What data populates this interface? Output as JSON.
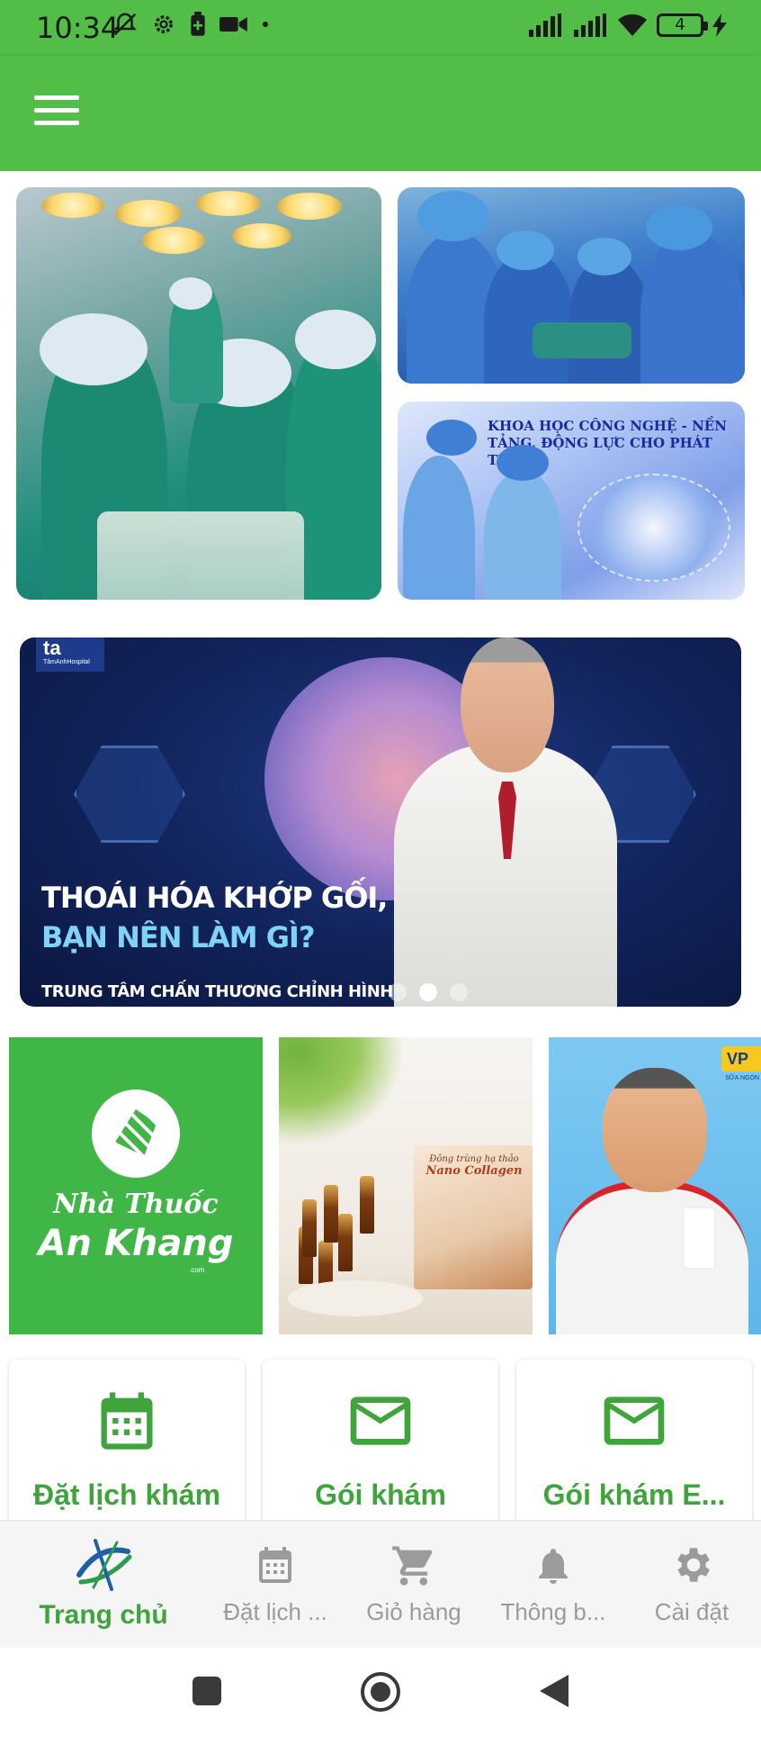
{
  "status_bar": {
    "time": "10:34",
    "battery_level": "4",
    "icons_left": [
      "muted-bell-icon",
      "gear-icon",
      "battery-saver-icon",
      "video-camera-icon",
      "dot-icon"
    ],
    "icons_right": [
      "signal-icon",
      "signal-icon",
      "wifi-icon",
      "battery-icon",
      "charging-bolt-icon"
    ]
  },
  "app_bar": {
    "menu_icon": "hamburger-menu-icon",
    "background_color": "#52bd47"
  },
  "gallery": {
    "science_caption": "KHOA HỌC CÔNG NGHỆ - NỀN TẢNG, ĐỘNG LỰC CHO PHÁT TRIỂN"
  },
  "banner": {
    "logo_text": "ta",
    "logo_subtext": "TâmAnhHospital",
    "headline_1": "THOÁI HÓA KHỚP GỐI,",
    "headline_2": "BẠN NÊN LÀM GÌ?",
    "footer": "TRUNG TÂM CHẤN THƯƠNG CHỈNH HÌNH",
    "slide_count": 3,
    "active_slide": 2
  },
  "ads": {
    "ankhang_line1": "Nhà Thuốc",
    "ankhang_line2": "An Khang",
    "ankhang_com": ".com",
    "collagen_small": "Đông trùng hạ thảo",
    "collagen_name": "Nano Collagen",
    "vp_badge": "VP",
    "vp_sub": "SỮA NGON"
  },
  "cards": [
    {
      "label": "Đặt lịch khám",
      "icon": "calendar-icon"
    },
    {
      "label": "Gói khám",
      "icon": "mail-icon"
    },
    {
      "label": "Gói khám E...",
      "icon": "mail-icon"
    }
  ],
  "bottom_nav": [
    {
      "label": "Trang chủ",
      "icon": "app-logo-icon",
      "active": true
    },
    {
      "label": "Đặt lịch ...",
      "icon": "calendar-icon",
      "active": false
    },
    {
      "label": "Giỏ hàng",
      "icon": "cart-icon",
      "active": false
    },
    {
      "label": "Thông b...",
      "icon": "bell-icon",
      "active": false
    },
    {
      "label": "Cài đặt",
      "icon": "gear-icon",
      "active": false
    }
  ],
  "colors": {
    "brand_green": "#52bd47",
    "accent_green": "#3ea43b",
    "nav_inactive": "#9b9b9b"
  }
}
